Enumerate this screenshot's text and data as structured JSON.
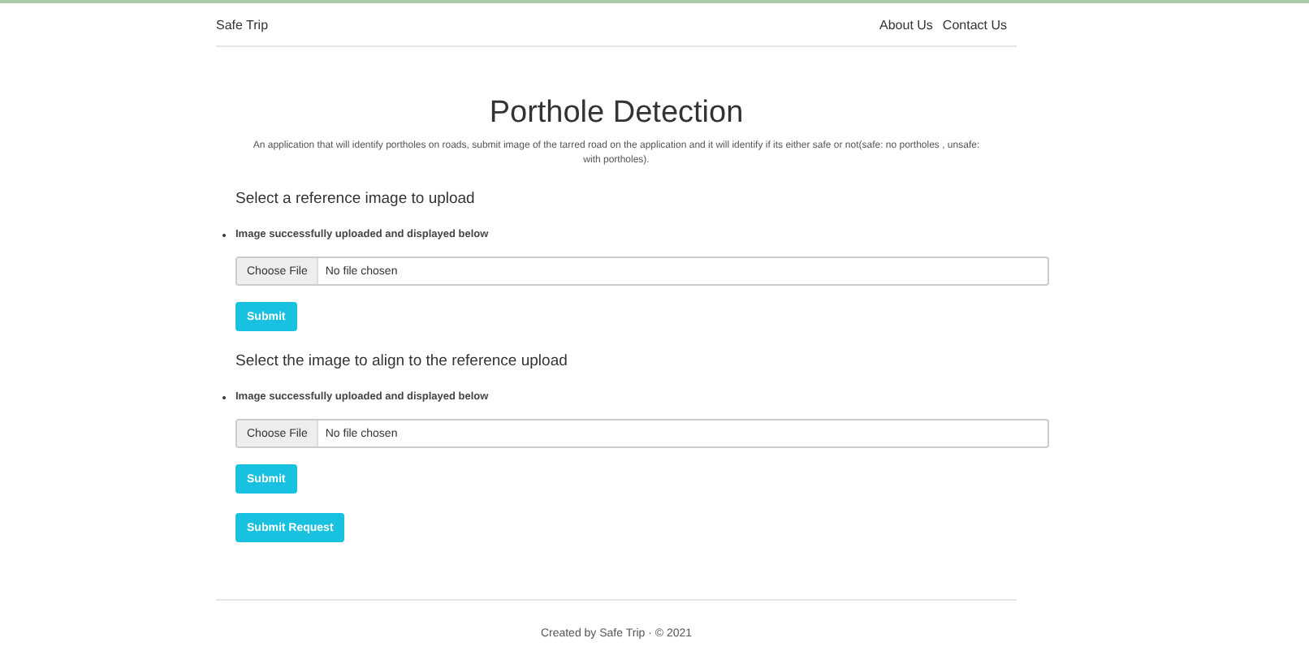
{
  "navbar": {
    "brand": "Safe Trip",
    "links": [
      "About Us",
      "Contact Us"
    ]
  },
  "title": "Porthole Detection",
  "description": "An application that will identify portholes on roads, submit image of the tarred road on the application and it will identify if its either safe or not(safe: no portholes , unsafe: with portholes).",
  "sections": [
    {
      "heading": "Select a reference image to upload",
      "message": "Image successfully uploaded and displayed below",
      "file_button": "Choose File",
      "file_status": "No file chosen",
      "submit": "Submit"
    },
    {
      "heading": "Select the image to align to the reference upload",
      "message": "Image successfully uploaded and displayed below",
      "file_button": "Choose File",
      "file_status": "No file chosen",
      "submit": "Submit"
    }
  ],
  "request_button": "Submit Request",
  "footer": "Created by Safe Trip · © 2021"
}
